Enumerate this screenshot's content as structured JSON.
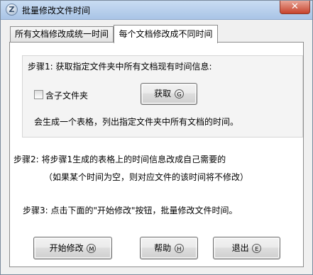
{
  "window": {
    "title": "批量修改文件时间",
    "app_icon": "Z",
    "close_glyph": "✕"
  },
  "tabs": [
    {
      "label": "所有文档修改成统一时间",
      "active": false
    },
    {
      "label": "每个文档修改成不同时间",
      "active": true
    }
  ],
  "step1": {
    "heading": "步骤1: 获取指定文件夹中所有文档现有时间信息:",
    "checkbox_label": "含子文件夹",
    "checkbox_checked": false,
    "fetch_button": {
      "label": "获取",
      "key": "G"
    },
    "description": "会生成一个表格，列出指定文件夹中所有文档的时间。"
  },
  "step2": {
    "line1": "步骤2: 将步骤1生成的表格上的时间信息改成自己需要的",
    "line2": "（如果某个时间为空，则对应文件的该时间将不修改）"
  },
  "step3": {
    "text": "步骤3: 点击下面的\"开始修改\"按钮，批量修改文件时间。"
  },
  "buttons": {
    "start": {
      "label": "开始修改",
      "key": "M"
    },
    "help": {
      "label": "帮助",
      "key": "H"
    },
    "exit": {
      "label": "退出",
      "key": "E"
    }
  }
}
